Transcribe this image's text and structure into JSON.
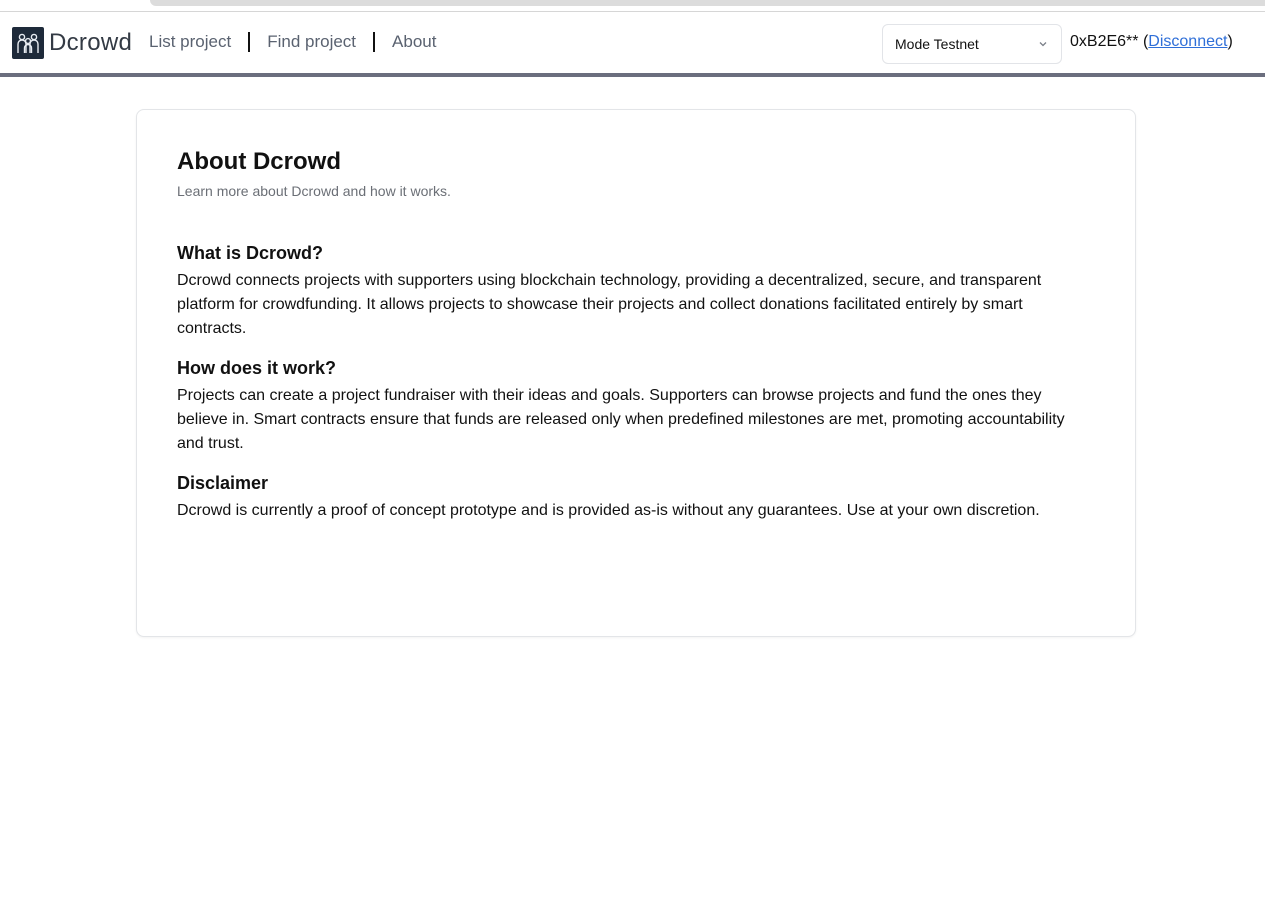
{
  "brand": {
    "name": "Dcrowd",
    "logo_icon": "people-group-icon",
    "logo_bg": "#1e2a3a"
  },
  "nav": {
    "links": [
      "List project",
      "Find project",
      "About"
    ]
  },
  "network_select": {
    "value": "Mode Testnet",
    "icon": "chevron-down-icon"
  },
  "account": {
    "address": "0xB2E6**",
    "open_paren": " (",
    "disconnect_label": "Disconnect",
    "close_paren": ")",
    "link_color": "#2f6fd8"
  },
  "about": {
    "title": "About Dcrowd",
    "subtitle": "Learn more about Dcrowd and how it works.",
    "sections": [
      {
        "heading": "What is Dcrowd?",
        "body": "Dcrowd connects projects with supporters using blockchain technology, providing a decentralized, secure, and transparent platform for crowdfunding. It allows projects to showcase their projects and collect donations facilitated entirely by smart contracts."
      },
      {
        "heading": "How does it work?",
        "body": "Projects can create a project fundraiser with their ideas and goals. Supporters can browse projects and fund the ones they believe in. Smart contracts ensure that funds are released only when predefined milestones are met, promoting accountability and trust."
      },
      {
        "heading": "Disclaimer",
        "body": "Dcrowd is currently a proof of concept prototype and is provided as-is without any guarantees. Use at your own discretion."
      }
    ]
  },
  "colors": {
    "navbar_border": "#6b6e7e",
    "muted_text": "#6b6f76"
  }
}
